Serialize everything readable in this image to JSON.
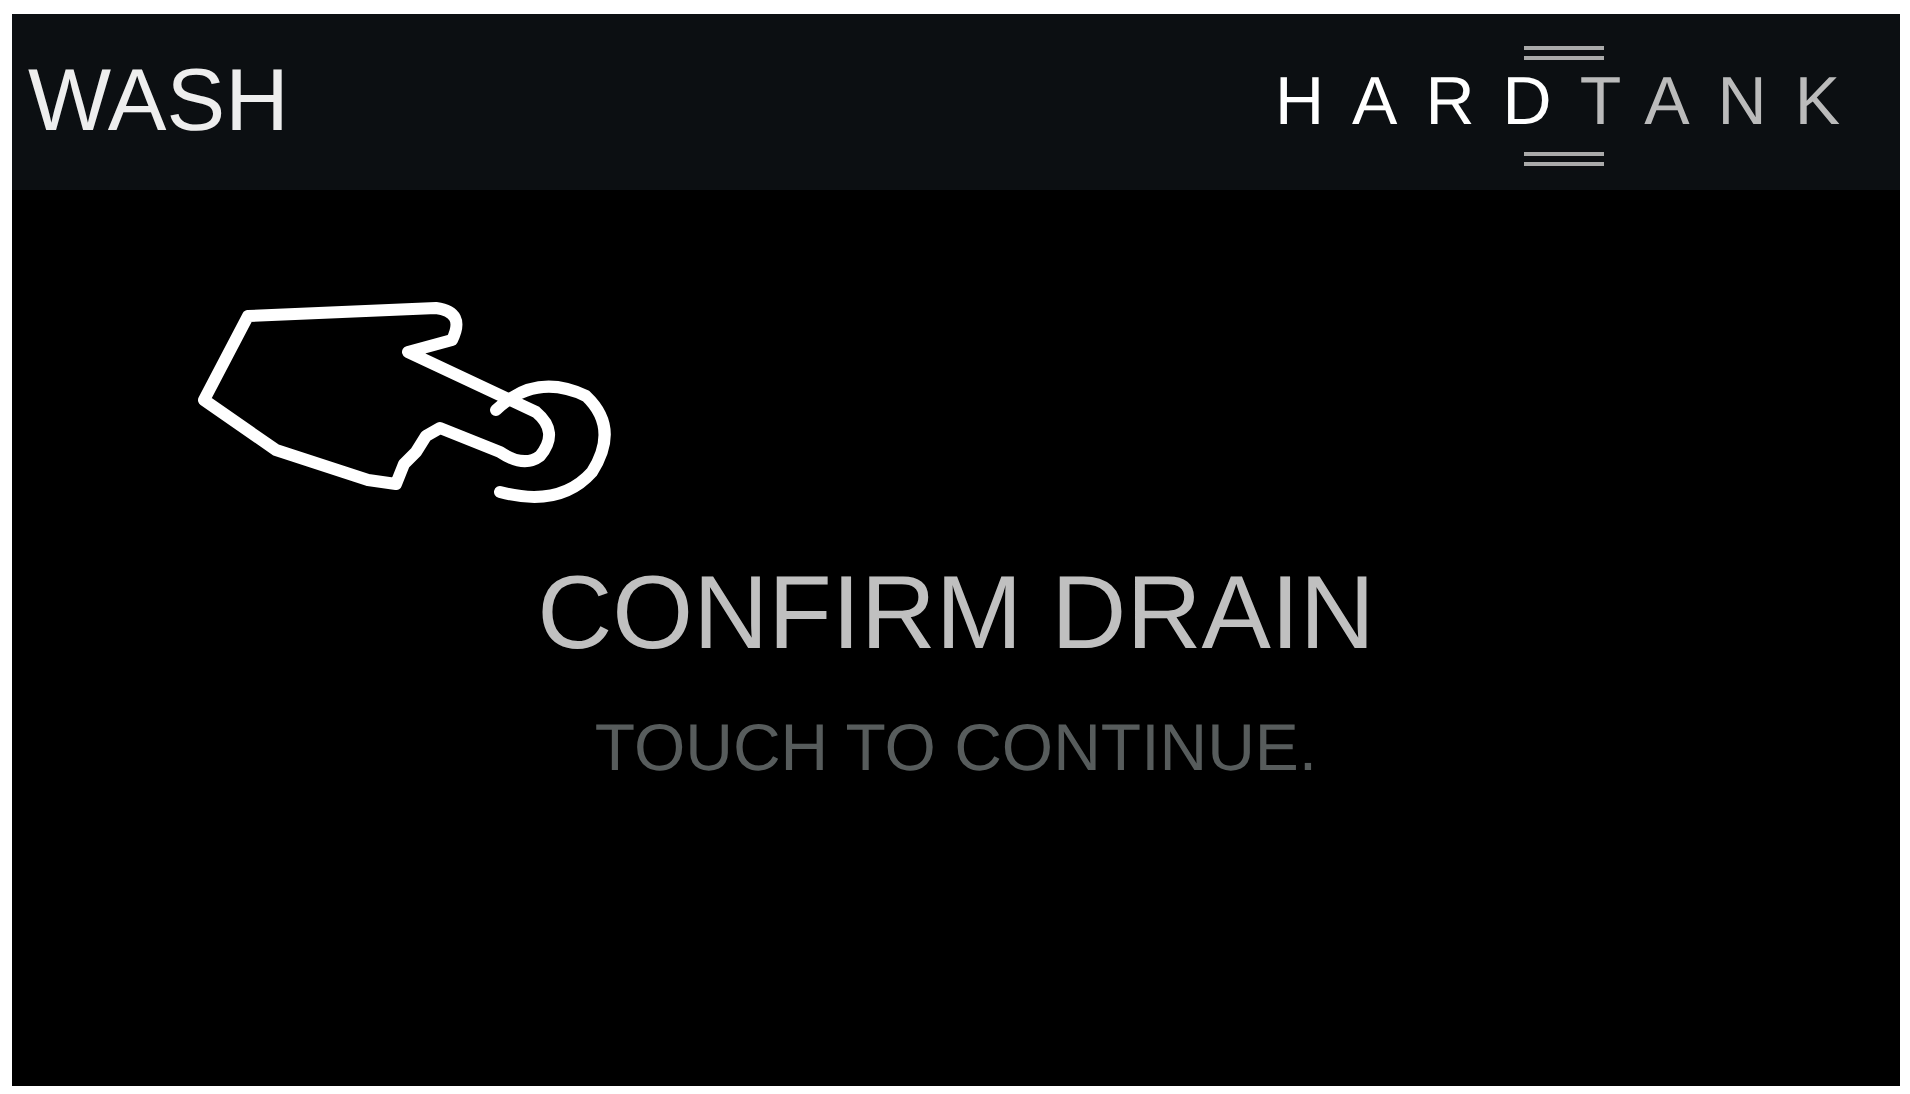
{
  "header": {
    "title": "WASH",
    "logo": {
      "part_1": "HARD",
      "part_2": "TANK"
    }
  },
  "prompt": {
    "title": "CONFIRM DRAIN",
    "subtitle": "TOUCH TO CONTINUE."
  }
}
